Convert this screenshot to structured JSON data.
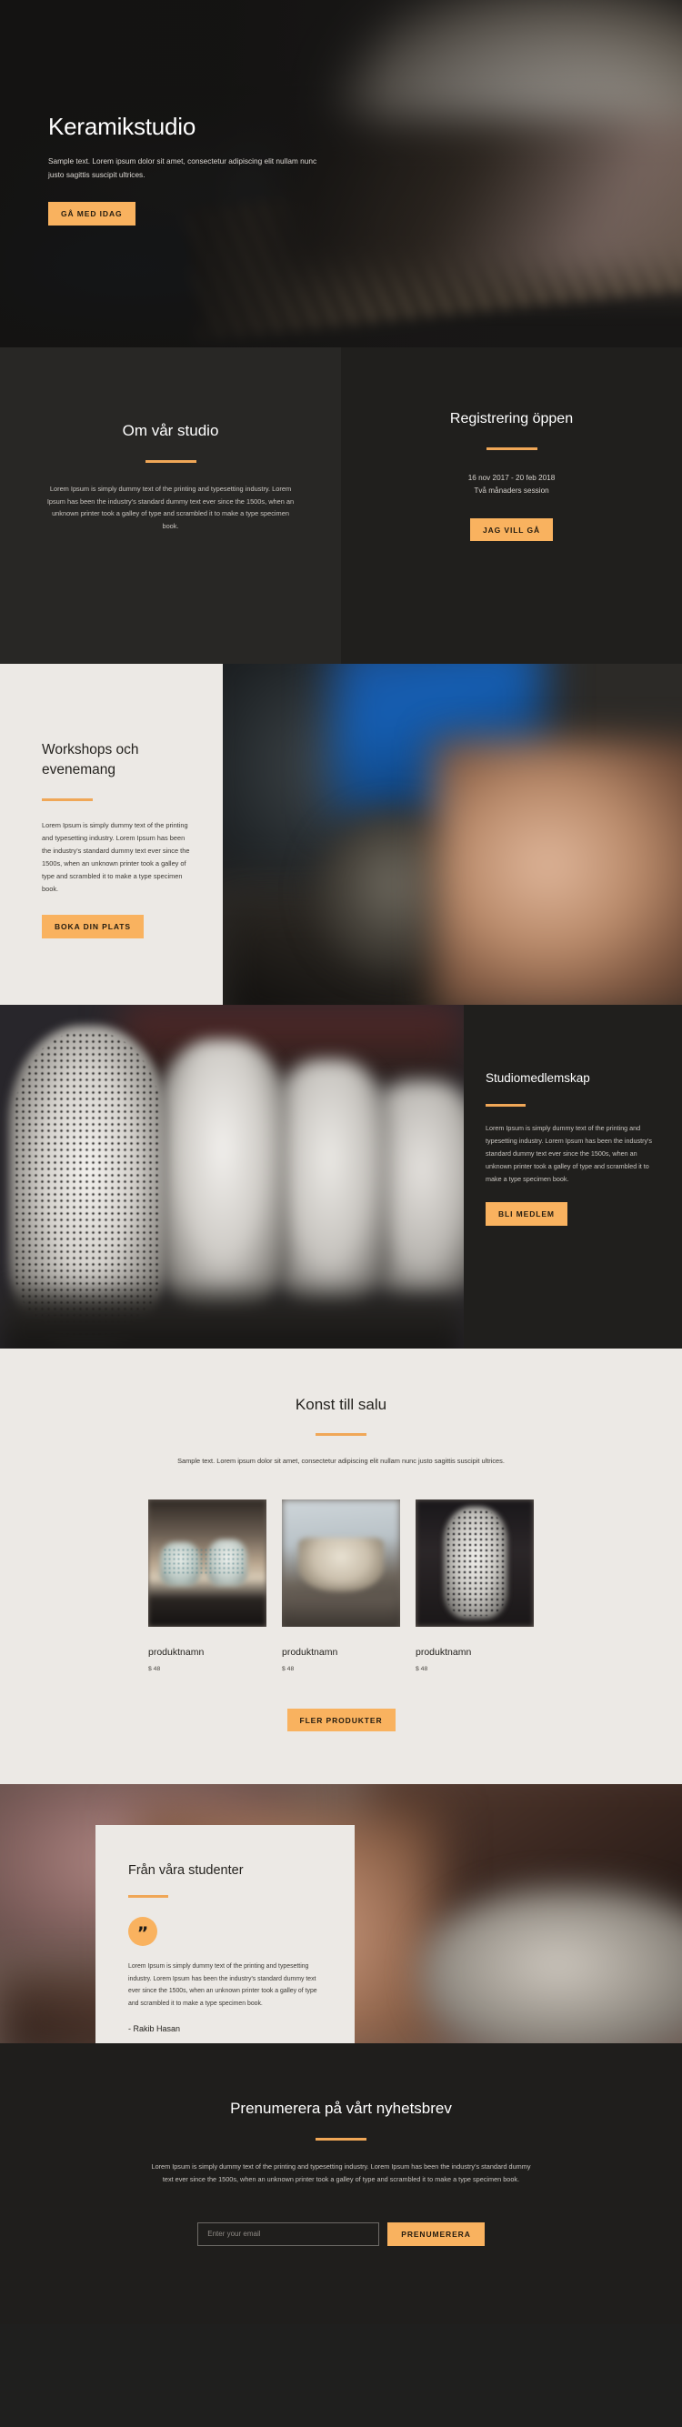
{
  "theme": {
    "accent": "#f9b25f",
    "accent_rule": "#f0a757",
    "dark_bg": "#1f1e1c",
    "panel_dark": "#282725",
    "panel_darker": "#201f1d",
    "light_bg": "#ece9e5"
  },
  "hero": {
    "title": "Keramikstudio",
    "subtitle": "Sample text. Lorem ipsum dolor sit amet, consectetur adipiscing elit nullam nunc justo sagittis suscipit ultrices.",
    "cta_label": "GÅ MED IDAG"
  },
  "about": {
    "title": "Om vår studio",
    "body": "Lorem Ipsum is simply dummy text of the printing and typesetting industry. Lorem Ipsum has been the industry's standard dummy text ever since the 1500s, when an unknown printer took a galley of type and scrambled it to make a type specimen book."
  },
  "registration": {
    "title": "Registrering öppen",
    "dates": "16 nov 2017 - 20 feb 2018",
    "session": "Två månaders session",
    "cta_label": "JAG VILL GÅ"
  },
  "workshops": {
    "title": "Workshops och evenemang",
    "body": "Lorem Ipsum is simply dummy text of the printing and typesetting industry. Lorem Ipsum has been the industry's standard dummy text ever since the 1500s, when an unknown printer took a galley of type and scrambled it to make a type specimen book.",
    "cta_label": "BOKA DIN PLATS"
  },
  "membership": {
    "title": "Studiomedlemskap",
    "body": "Lorem Ipsum is simply dummy text of the printing and typesetting industry. Lorem Ipsum has been the industry's standard dummy text ever since the 1500s, when an unknown printer took a galley of type and scrambled it to make a type specimen book.",
    "cta_label": "BLI MEDLEM"
  },
  "products": {
    "title": "Konst till salu",
    "subtitle": "Sample text. Lorem ipsum dolor sit amet, consectetur adipiscing elit nullam nunc justo sagittis suscipit ultrices.",
    "items": [
      {
        "name": "produktnamn",
        "price": "$ 48"
      },
      {
        "name": "produktnamn",
        "price": "$ 48"
      },
      {
        "name": "produktnamn",
        "price": "$ 48"
      }
    ],
    "more_label": "FLER PRODUKTER"
  },
  "testimonial": {
    "title": "Från våra studenter",
    "quote_icon": "quote-mark",
    "body": "Lorem Ipsum is simply dummy text of the printing and typesetting industry. Lorem Ipsum has been the industry's standard dummy text ever since the 1500s, when an unknown printer took a galley of type and scrambled it to make a type specimen book.",
    "author": "- Rakib Hasan"
  },
  "newsletter": {
    "title": "Prenumerera på vårt nyhetsbrev",
    "body": "Lorem Ipsum is simply dummy text of the printing and typesetting industry. Lorem Ipsum has been the industry's standard dummy text ever since the 1500s, when an unknown printer took a galley of type and scrambled it to make a type specimen book.",
    "email_placeholder": "Enter your email",
    "email_value": "",
    "cta_label": "PRENUMERERA"
  }
}
